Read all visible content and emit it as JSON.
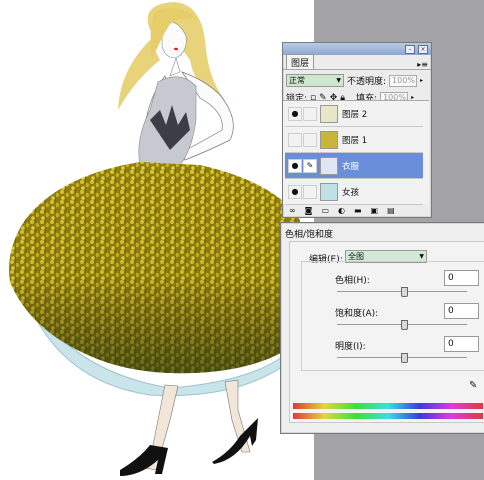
{
  "layers_panel": {
    "tab": "图层",
    "blend_mode": "正常",
    "opacity_label": "不透明度:",
    "opacity_value": "100%",
    "lock_label": "锁定:",
    "fill_label": "填充:",
    "fill_value": "100%",
    "layers": [
      {
        "name": "图层 2",
        "visible": true,
        "selected": false
      },
      {
        "name": "图层 1",
        "visible": false,
        "selected": false
      },
      {
        "name": "衣服",
        "visible": true,
        "selected": true
      },
      {
        "name": "女孩",
        "visible": true,
        "selected": false
      }
    ]
  },
  "hue_dialog": {
    "title": "色相/饱和度",
    "edit_label": "编辑(E):",
    "edit_value": "全图",
    "hue_label": "色相(H):",
    "hue_value": "0",
    "sat_label": "饱和度(A):",
    "sat_value": "0",
    "light_label": "明度(I):",
    "light_value": "0"
  },
  "colors": {
    "selected_layer": "#6a8fd8",
    "skirt_yellow": "#b9a51d",
    "hair": "#e9d37a",
    "gray_workspace": "#a4a4a8"
  }
}
